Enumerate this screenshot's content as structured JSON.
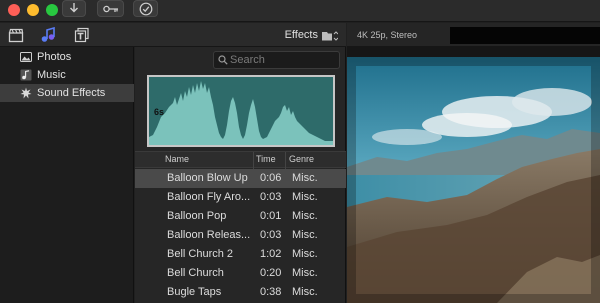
{
  "titlebar": {
    "traffic_colors": [
      "#fe5f57",
      "#febc2e",
      "#28c840"
    ],
    "buttons": [
      "download-icon",
      "key-icon",
      "checkmark-circle-icon"
    ]
  },
  "browser": {
    "header_icons": [
      "clapperboard-icon",
      "music-notes-icon",
      "title-t-icon"
    ],
    "title": "Effects",
    "folder_icon": "folder-icon"
  },
  "viewer": {
    "format": "4K 25p, Stereo"
  },
  "sidebar": {
    "items": [
      {
        "label": "Photos",
        "icon": "photos-icon",
        "selected": false
      },
      {
        "label": "Music",
        "icon": "music-icon",
        "selected": false
      },
      {
        "label": "Sound Effects",
        "icon": "sound-effects-icon",
        "selected": true
      }
    ]
  },
  "search": {
    "placeholder": "Search"
  },
  "waveform": {
    "duration_label": "6s",
    "color": "#2e6b6a"
  },
  "table": {
    "columns": [
      "Name",
      "Time",
      "Genre"
    ],
    "rows": [
      {
        "name": "Balloon Blow Up",
        "time": "0:06",
        "genre": "Misc.",
        "selected": true
      },
      {
        "name": "Balloon Fly Aro...",
        "time": "0:03",
        "genre": "Misc.",
        "selected": false
      },
      {
        "name": "Balloon Pop",
        "time": "0:01",
        "genre": "Misc.",
        "selected": false
      },
      {
        "name": "Balloon Releas...",
        "time": "0:03",
        "genre": "Misc.",
        "selected": false
      },
      {
        "name": "Bell Church 2",
        "time": "1:02",
        "genre": "Misc.",
        "selected": false
      },
      {
        "name": "Bell Church",
        "time": "0:20",
        "genre": "Misc.",
        "selected": false
      },
      {
        "name": "Bugle Taps",
        "time": "0:38",
        "genre": "Misc.",
        "selected": false
      }
    ]
  }
}
